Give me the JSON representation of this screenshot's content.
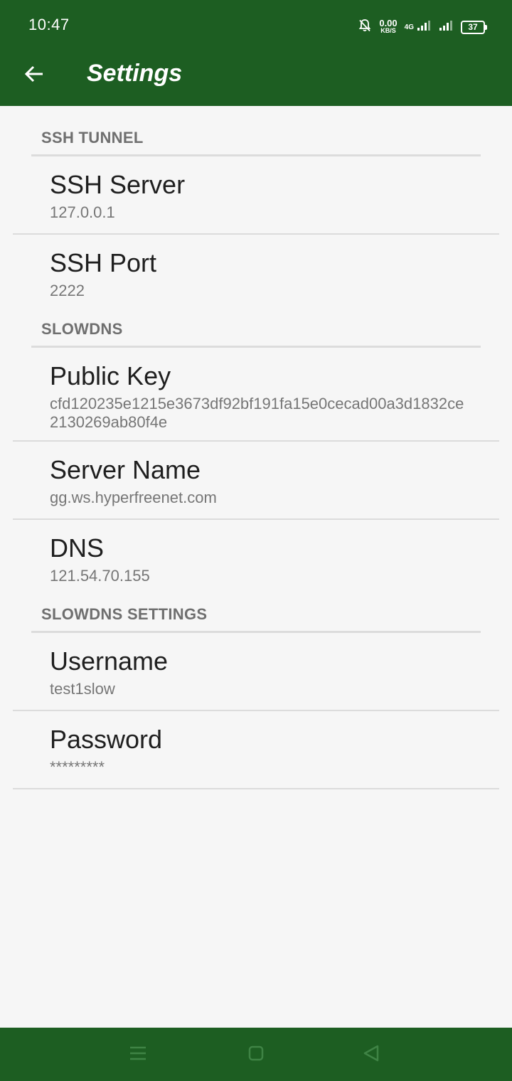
{
  "status": {
    "time": "10:47",
    "net_speed_value": "0.00",
    "net_speed_unit": "KB/S",
    "network_type": "4G",
    "battery": "37"
  },
  "toolbar": {
    "title": "Settings",
    "back_icon": "arrow-left-icon"
  },
  "sections": [
    {
      "header": "SSH TUNNEL",
      "items": [
        {
          "title": "SSH Server",
          "summary": "127.0.0.1"
        },
        {
          "title": "SSH Port",
          "summary": "2222"
        }
      ]
    },
    {
      "header": "SLOWDNS",
      "items": [
        {
          "title": "Public Key",
          "summary": "cfd120235e1215e3673df92bf191fa15e0cecad00a3d1832ce2130269ab80f4e"
        },
        {
          "title": "Server Name",
          "summary": "gg.ws.hyperfreenet.com"
        },
        {
          "title": "DNS",
          "summary": "121.54.70.155"
        }
      ]
    },
    {
      "header": "SLOWDNS SETTINGS",
      "items": [
        {
          "title": "Username",
          "summary": "test1slow"
        },
        {
          "title": "Password",
          "summary": "*********"
        }
      ]
    }
  ],
  "navbar": {
    "recents_icon": "menu-lines-icon",
    "home_icon": "square-home-icon",
    "back_icon": "triangle-back-icon"
  },
  "colors": {
    "primary": "#1d5e22",
    "background": "#f6f6f6",
    "divider": "#dcdcdc",
    "header_text": "#6f6f6f"
  }
}
